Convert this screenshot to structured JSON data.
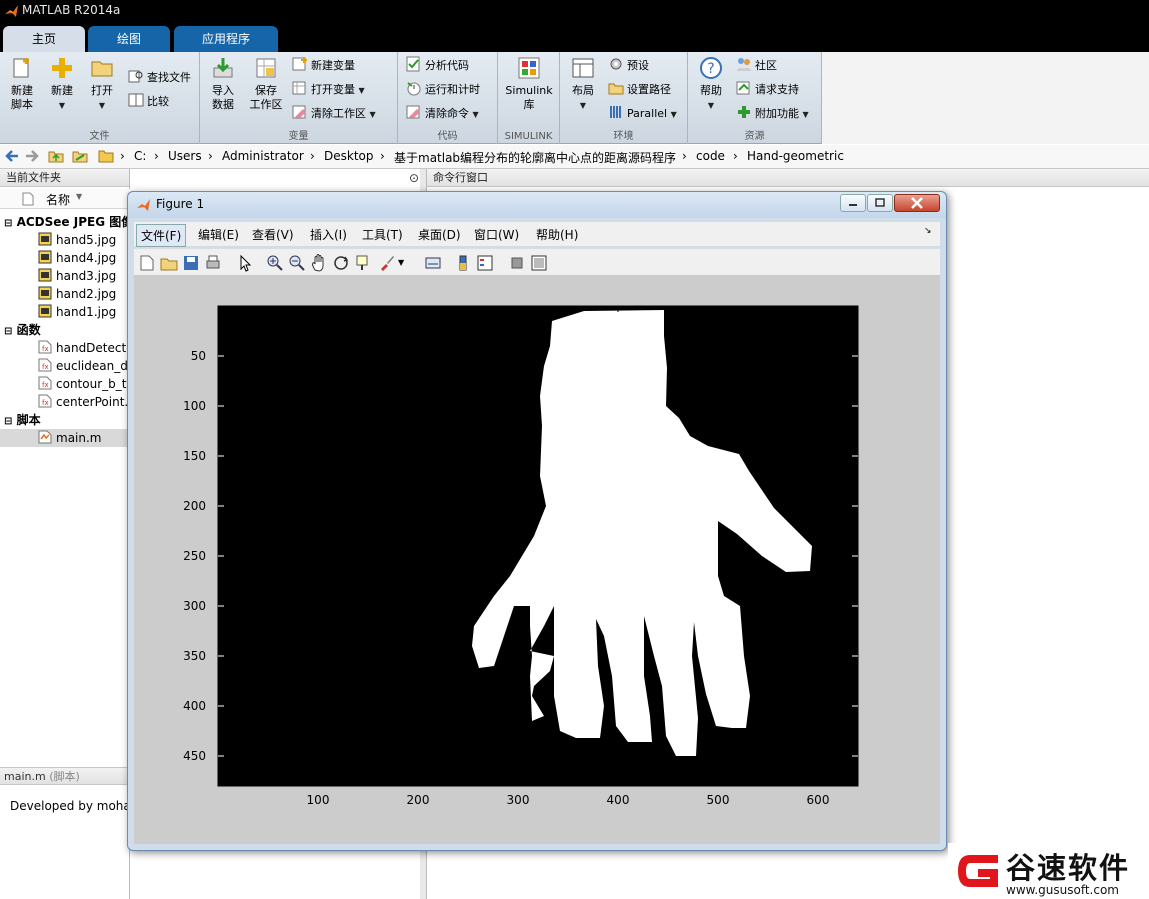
{
  "app": {
    "title": "MATLAB R2014a"
  },
  "tabs": [
    {
      "label": "主页"
    },
    {
      "label": "绘图"
    },
    {
      "label": "应用程序"
    }
  ],
  "ribbon": {
    "file": {
      "label": "文件",
      "new_script": [
        "新建",
        "脚本"
      ],
      "new": "新建",
      "open": "打开",
      "find_files": "查找文件",
      "compare": "比较"
    },
    "variable": {
      "label": "变量",
      "import": [
        "导入",
        "数据"
      ],
      "save": [
        "保存",
        "工作区"
      ],
      "new_var": "新建变量",
      "open_var": "打开变量",
      "clear_ws": "清除工作区"
    },
    "code": {
      "label": "代码",
      "analyze": "分析代码",
      "run_time": "运行和计时",
      "clear_cmd": "清除命令"
    },
    "simulink": {
      "label": "SIMULINK",
      "lib": [
        "Simulink",
        "库"
      ]
    },
    "env": {
      "label": "环境",
      "layout": "布局",
      "prefs": "预设",
      "set_path": "设置路径",
      "parallel": "Parallel"
    },
    "res": {
      "label": "资源",
      "help": "帮助",
      "community": "社区",
      "support": "请求支持",
      "addons": "附加功能"
    }
  },
  "address": {
    "crumbs": [
      "C:",
      "Users",
      "Administrator",
      "Desktop",
      "基于matlab编程分布的轮廓离中心点的距离源码程序",
      "code",
      "Hand-geometric"
    ]
  },
  "left_panel": {
    "title": "当前文件夹",
    "col_name": "名称",
    "sections": [
      {
        "label": "ACDSee JPEG 图像",
        "items": [
          "hand5.jpg",
          "hand4.jpg",
          "hand3.jpg",
          "hand2.jpg",
          "hand1.jpg"
        ]
      },
      {
        "label": "函数",
        "items": [
          "handDetect.",
          "euclidean_di",
          "contour_b_tr",
          "centerPoint."
        ]
      },
      {
        "label": "脚本",
        "items": [
          "main.m"
        ]
      }
    ],
    "detail_title": "main.m",
    "detail_sub": "(脚本)",
    "detail_text": "Developed by moha"
  },
  "command_window": {
    "title": "命令行窗口"
  },
  "figure": {
    "title": "Figure 1",
    "menus": [
      "文件(F)",
      "编辑(E)",
      "查看(V)",
      "插入(I)",
      "工具(T)",
      "桌面(D)",
      "窗口(W)",
      "帮助(H)"
    ],
    "axes": {
      "xticks": [
        "100",
        "200",
        "300",
        "400",
        "500",
        "600"
      ],
      "yticks": [
        "50",
        "100",
        "150",
        "200",
        "250",
        "300",
        "350",
        "400",
        "450"
      ]
    }
  },
  "watermark": {
    "brand": "谷速软件",
    "url": "www.gususoft.com"
  },
  "colors": {
    "accent": "#1565a8",
    "tab_active": "#d6dfe9",
    "watermark_red": "#e0161c"
  }
}
